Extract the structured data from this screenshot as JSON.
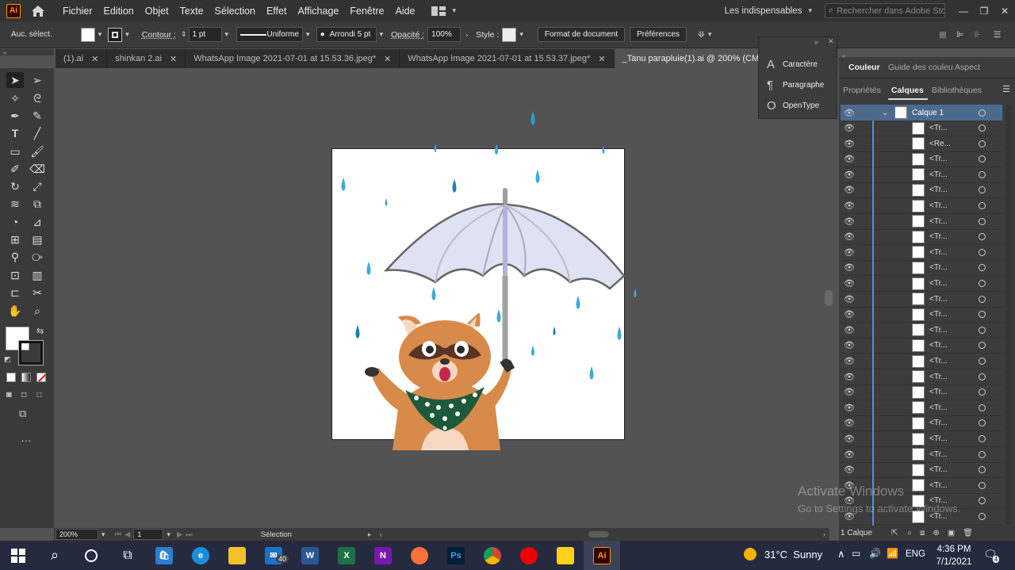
{
  "menubar": {
    "app_logo": "Ai",
    "items": [
      "Fichier",
      "Edition",
      "Objet",
      "Texte",
      "Sélection",
      "Effet",
      "Affichage",
      "Fenêtre",
      "Aide"
    ],
    "workspace": "Les indispensables",
    "search_placeholder": "Rechercher dans Adobe Stock"
  },
  "control": {
    "selection_state": "Auc. sélect.",
    "stroke_label": "Contour :",
    "stroke_weight": "1 pt",
    "stroke_profile": "Uniforme",
    "brush": "Arrondi 5 pt",
    "opacity_label": "Opacité :",
    "opacity_value": "100%",
    "style_label": "Style :",
    "doc_format_btn": "Format de document",
    "prefs_btn": "Préférences"
  },
  "tabs": [
    {
      "label": "(1).ai",
      "active": false
    },
    {
      "label": "shinkan 2.ai",
      "active": false
    },
    {
      "label": "WhatsApp Image 2021-07-01 at 15.53.36.jpeg*",
      "active": false
    },
    {
      "label": "WhatsApp Image 2021-07-01 at 15.53.37.jpeg*",
      "active": false
    },
    {
      "label": "_Tanu parapluie(1).ai @ 200% (CMJN/Aperçu)",
      "active": true
    }
  ],
  "char_panel": {
    "items": [
      {
        "glyph": "A",
        "label": "Caractère"
      },
      {
        "glyph": "¶",
        "label": "Paragraphe"
      },
      {
        "glyph": "O",
        "label": "OpenType"
      }
    ]
  },
  "right_panel": {
    "top_tabs": [
      "Couleur",
      "Guide des couleu",
      "Aspect"
    ],
    "tabs": [
      "Propriétés",
      "Calques",
      "Bibliothèques"
    ],
    "active_tab": "Calques",
    "layer": {
      "name": "Calque 1"
    },
    "sublayers": [
      "<Tr...",
      "<Re...",
      "<Tr...",
      "<Tr...",
      "<Tr...",
      "<Tr...",
      "<Tr...",
      "<Tr...",
      "<Tr...",
      "<Tr...",
      "<Tr...",
      "<Tr...",
      "<Tr...",
      "<Tr...",
      "<Tr...",
      "<Tr...",
      "<Tr...",
      "<Tr...",
      "<Tr...",
      "<Tr...",
      "<Tr...",
      "<Tr...",
      "<Tr...",
      "<Tr...",
      "<Tr...",
      "<Tr...",
      "<Tr..."
    ],
    "footer_count": "1 Calque"
  },
  "status": {
    "zoom": "200%",
    "page": "1",
    "tool": "Sélection"
  },
  "watermark": {
    "title": "Activate Windows",
    "subtitle": "Go to Settings to activate Windows."
  },
  "taskbar": {
    "mail_badge": "40",
    "weather": "31°C  Sunny",
    "lang": "ENG",
    "time": "4:36 PM",
    "date": "7/1/2021",
    "notif_count": "4"
  },
  "colors": {
    "accent_ai": "#ff9a00",
    "selection_blue": "#4a90e2",
    "rain": "#3fa9dc",
    "raccoon": "#d88a4a"
  }
}
